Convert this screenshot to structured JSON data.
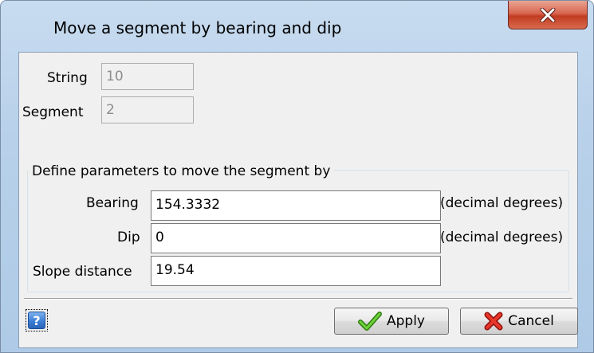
{
  "window": {
    "title": "Move a segment by bearing and dip"
  },
  "info": {
    "string_label": "String",
    "string_value": "10",
    "segment_label": "Segment",
    "segment_value": "2"
  },
  "group": {
    "title": "Define parameters to move the segment by",
    "bearing_label": "Bearing",
    "bearing_value": "154.3332",
    "bearing_unit": "(decimal degrees)",
    "dip_label": "Dip",
    "dip_value": "0",
    "dip_unit": "(decimal degrees)",
    "slope_label": "Slope distance",
    "slope_value": "19.54"
  },
  "buttons": {
    "help_glyph": "?",
    "apply_label": "Apply",
    "cancel_label": "Cancel"
  },
  "icons": {
    "close": "close-icon",
    "help": "help-icon",
    "apply": "checkmark-icon",
    "cancel": "red-x-icon"
  },
  "colors": {
    "close_button": "#c23b22",
    "apply_check": "#4caf1e",
    "cancel_x": "#d8261b",
    "help_blue": "#3d7fd6"
  }
}
